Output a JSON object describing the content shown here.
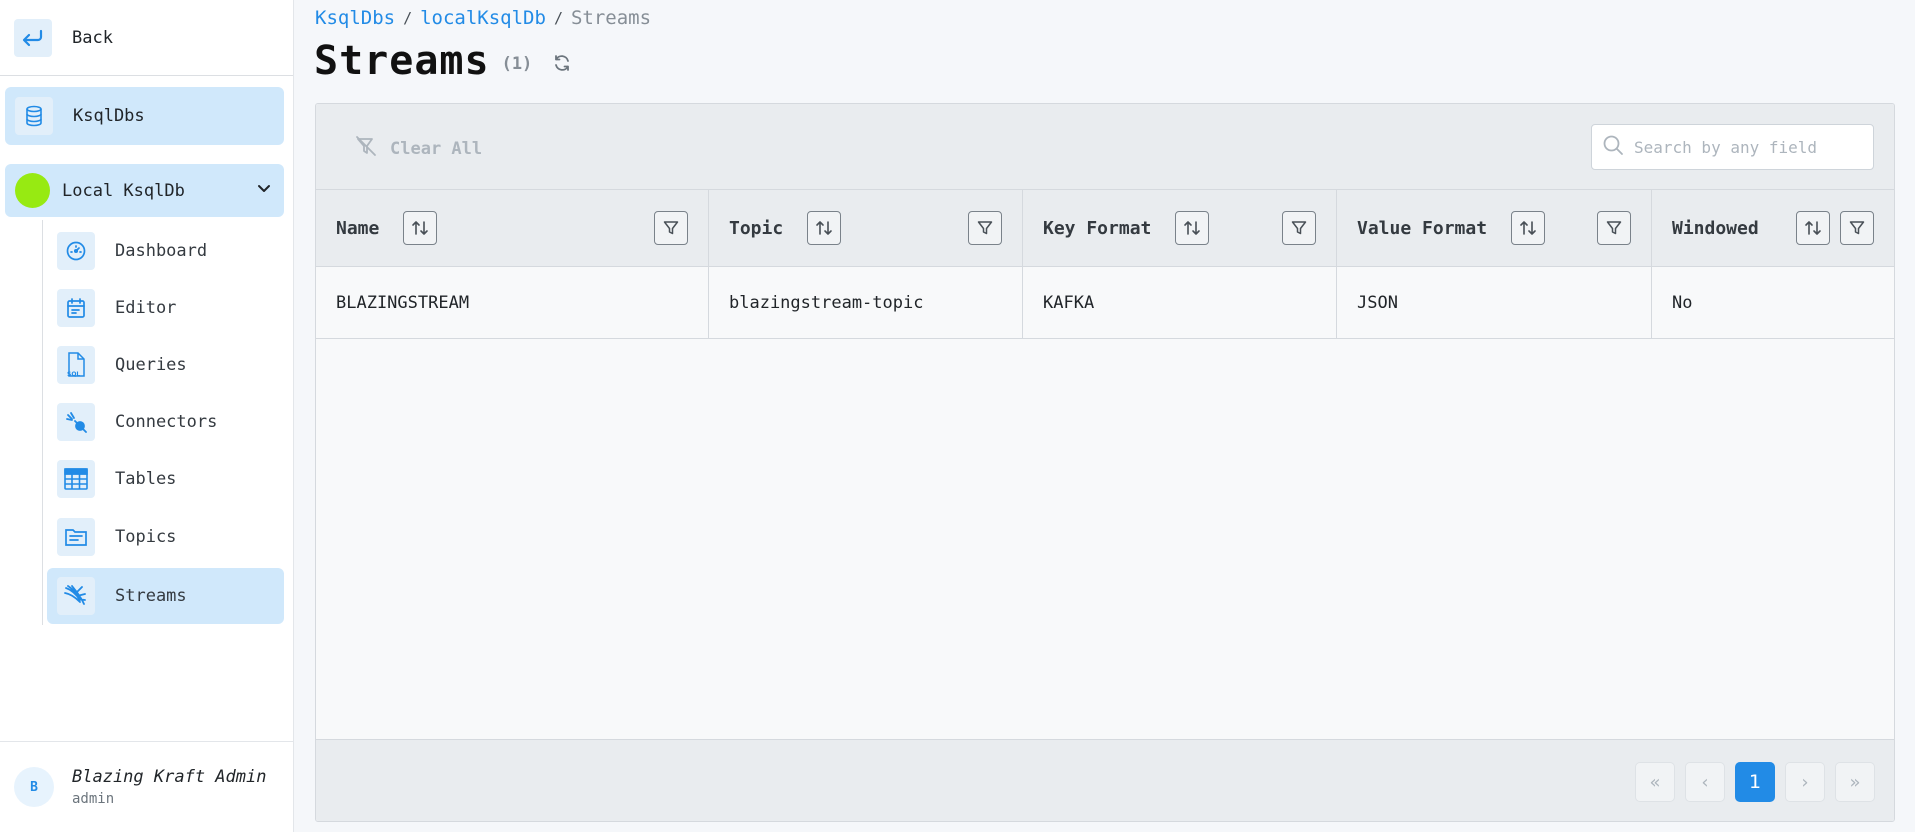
{
  "sidebar": {
    "back_label": "Back",
    "ksqldbs_label": "KsqlDbs",
    "cluster_label": "Local KsqlDb",
    "cluster_status_color": "#97ea12",
    "items": [
      {
        "label": "Dashboard",
        "icon": "dashboard-gauge-icon"
      },
      {
        "label": "Editor",
        "icon": "editor-calendar-icon"
      },
      {
        "label": "Queries",
        "icon": "sql-file-icon"
      },
      {
        "label": "Connectors",
        "icon": "connectors-plug-icon"
      },
      {
        "label": "Tables",
        "icon": "table-grid-icon"
      },
      {
        "label": "Topics",
        "icon": "topics-folder-icon"
      },
      {
        "label": "Streams",
        "icon": "streams-icon",
        "active": true
      }
    ],
    "user": {
      "initial": "B",
      "name": "Blazing Kraft Admin",
      "role": "admin"
    }
  },
  "breadcrumb": [
    "KsqlDbs",
    "localKsqlDb",
    "Streams"
  ],
  "page": {
    "title": "Streams",
    "count": "(1)"
  },
  "toolbar": {
    "clear_all_label": "Clear All",
    "search_placeholder": "Search by any field"
  },
  "table": {
    "columns": [
      "Name",
      "Topic",
      "Key Format",
      "Value Format",
      "Windowed"
    ],
    "rows": [
      [
        "BLAZINGSTREAM",
        "blazingstream-topic",
        "KAFKA",
        "JSON",
        "No"
      ]
    ]
  },
  "pagination": {
    "current_page": "1",
    "first": "«",
    "prev": "‹",
    "next": "›",
    "last": "»"
  },
  "colors": {
    "accent": "#228be6",
    "active_bg": "#d0e8fb"
  }
}
